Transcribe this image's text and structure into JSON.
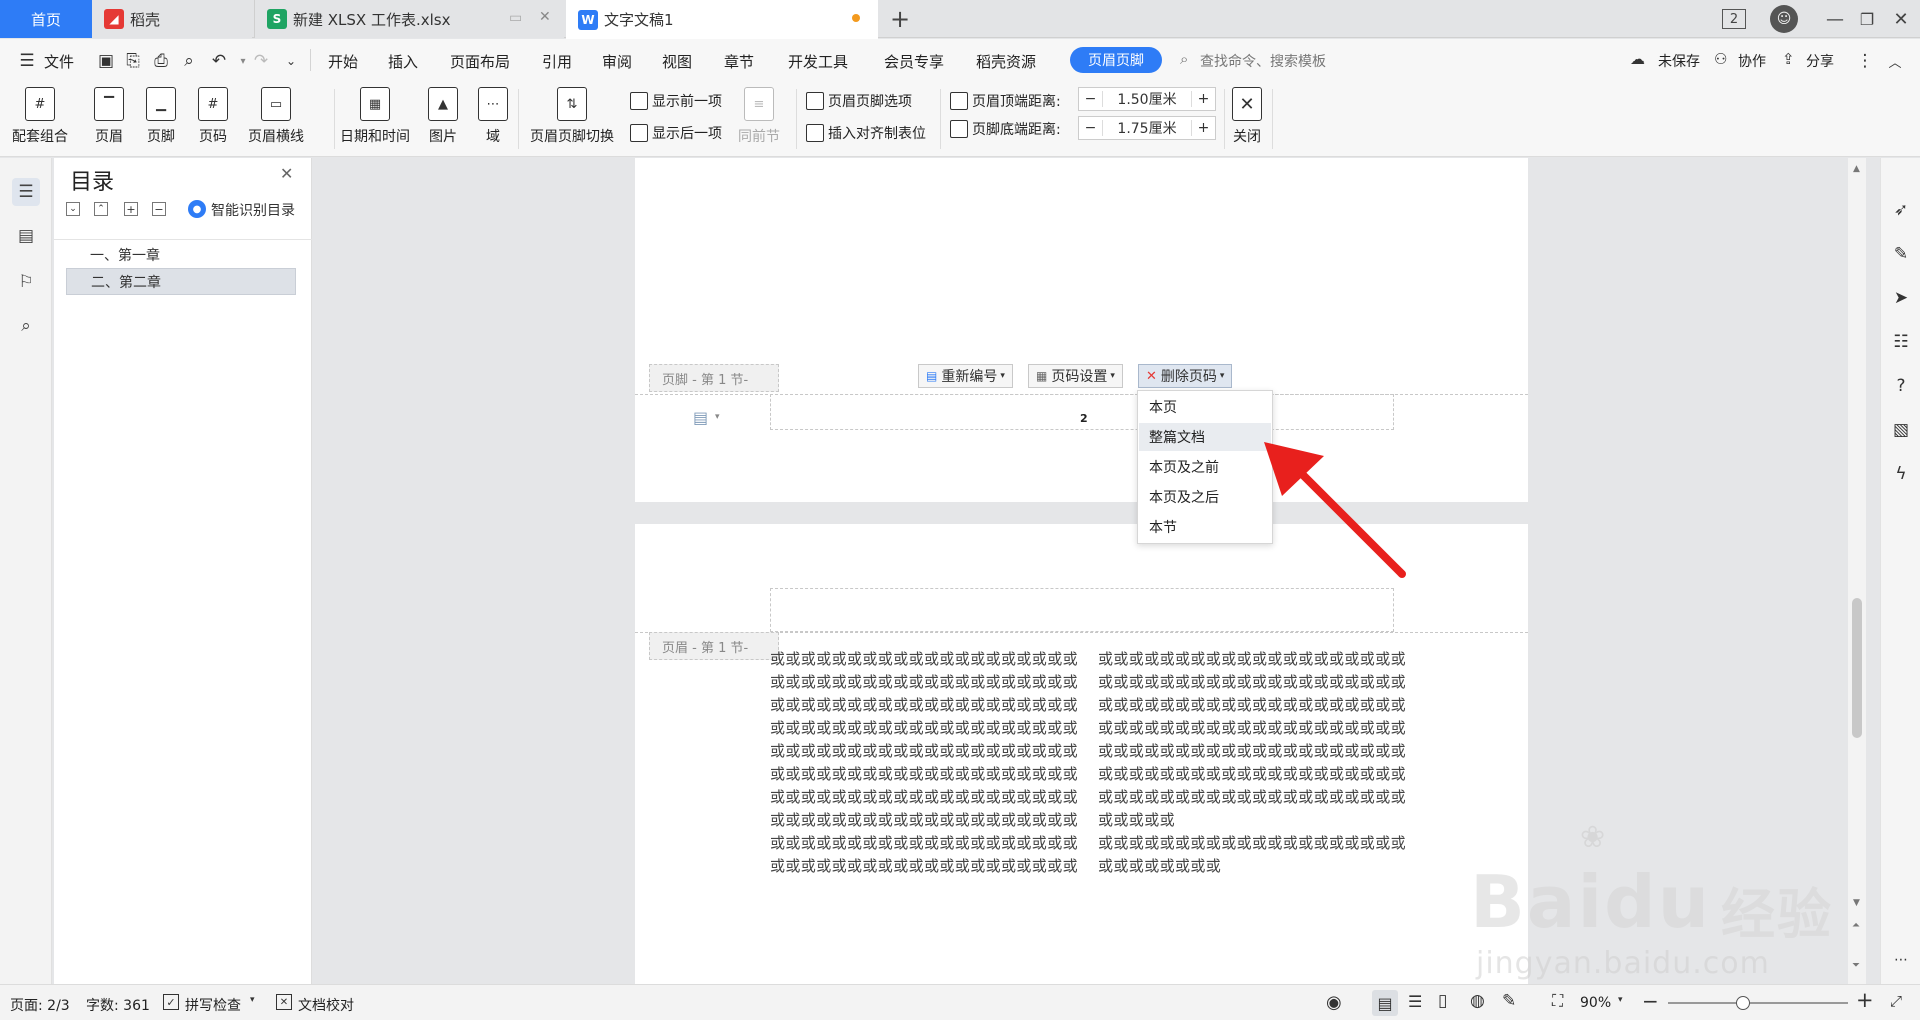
{
  "tabs": [
    {
      "label": "首页"
    },
    {
      "label": "稻壳"
    },
    {
      "label": "新建 XLSX 工作表.xlsx"
    },
    {
      "label": "文字文稿1"
    }
  ],
  "window": {
    "badge": "2"
  },
  "menu": {
    "file": "文件",
    "items": [
      "开始",
      "插入",
      "页面布局",
      "引用",
      "审阅",
      "视图",
      "章节",
      "开发工具",
      "会员专享",
      "稻壳资源"
    ],
    "active": "页眉页脚",
    "search_placeholder": "查找命令、搜索模板",
    "unsaved": "未保存",
    "collab": "协作",
    "share": "分享"
  },
  "ribbon": {
    "big": [
      "配套组合",
      "页眉",
      "页脚",
      "页码",
      "页眉横线",
      "日期和时间",
      "图片",
      "域",
      "页眉页脚切换"
    ],
    "show_prev": "显示前一项",
    "show_next": "显示后一项",
    "same_prev": "同前节",
    "options": "页眉页脚选项",
    "align_tab": "插入对齐制表位",
    "header_top_label": "页眉顶端距离:",
    "header_top_value": "1.50厘米",
    "footer_bottom_label": "页脚底端距离:",
    "footer_bottom_value": "1.75厘米",
    "close": "关闭",
    "minus": "−",
    "plus": "+"
  },
  "toc": {
    "title": "目录",
    "smart": "智能识别目录",
    "items": [
      "一、第一章",
      "二、第二章"
    ]
  },
  "document": {
    "footer_tag": "页脚 - 第 1 节-",
    "header_tag": "页眉 - 第 1 节-",
    "renumber": "重新编号",
    "page_num_settings": "页码设置",
    "delete_page_num": "删除页码",
    "page_number": "2",
    "col1_lines": [
      "或或或或或或或或或或或或或或或或或或或或",
      "或或或或或或或或或或或或或或或或或或或或",
      "或或或或或或或或或或或或或或或或或或或或",
      "或或或或或或或或或或或或或或或或或或或或",
      "或或或或或或或或或或或或或或或或或或或或",
      "或或或或或或或或或或或或或或或或或或或或",
      "或或或或或或或或或或或或或或或或或或或或",
      "或或或或或或或或或或或或或或或或或或或或",
      "或或或或或或或或或或或或或或或或或或或或",
      "或或或或或或或或或或或或或或或或或或或或"
    ],
    "col2_lines": [
      "或或或或或或或或或或或或或或或或或或或或",
      "或或或或或或或或或或或或或或或或或或或或",
      "或或或或或或或或或或或或或或或或或或或或",
      "或或或或或或或或或或或或或或或或或或或或",
      "或或或或或或或或或或或或或或或或或或或或",
      "或或或或或或或或或或或或或或或或或或或或",
      "或或或或或或或或或或或或或或或或或或或或",
      "或或或或或",
      "或或或或或或或或或或或或或或或或或或或或",
      "或或或或或或或或"
    ]
  },
  "dropdown": {
    "items": [
      "本页",
      "整篇文档",
      "本页及之前",
      "本页及之后",
      "本节"
    ],
    "highlighted_index": 1
  },
  "status": {
    "page": "页面: 2/3",
    "words": "字数: 361",
    "spell": "拼写检查",
    "proof": "文档校对",
    "zoom": "90%"
  },
  "watermark": {
    "brand": "Bai",
    "brand2": "du",
    "cn": "经验",
    "url": "jingyan.baidu.com"
  },
  "colors": {
    "accent": "#2e7cf6",
    "arrow": "#e8201d",
    "daoke": "#e53935",
    "xlsx": "#1fa463"
  }
}
